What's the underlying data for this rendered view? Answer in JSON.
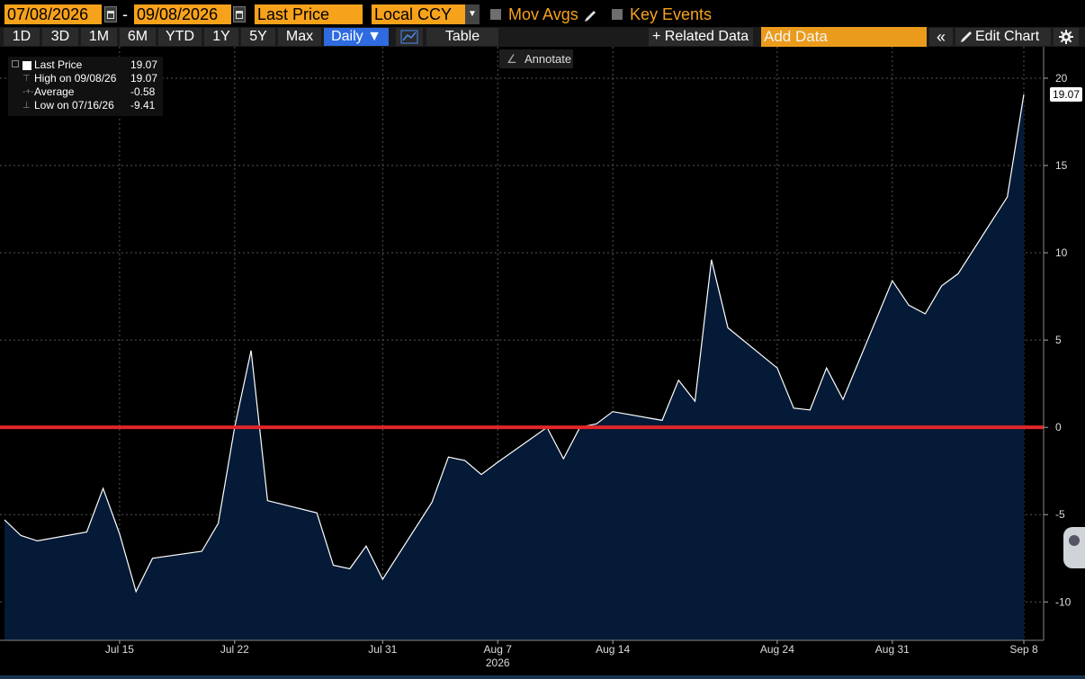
{
  "header": {
    "start_date": "07/08/2026",
    "end_date": "09/08/2026",
    "date_separator": "-",
    "field": "Last Price",
    "currency": "Local CCY",
    "mov_avgs_label": "Mov Avgs",
    "key_events_label": "Key Events"
  },
  "toolbar": {
    "ranges": [
      "1D",
      "3D",
      "1M",
      "6M",
      "YTD",
      "1Y",
      "5Y",
      "Max"
    ],
    "period_label": "Daily ▼",
    "table_label": "Table",
    "related_data_label": "+ Related Data",
    "add_data_placeholder": "Add Data",
    "collapse_label": "«",
    "edit_chart_label": "Edit Chart",
    "settings_icon": "gear-icon"
  },
  "annotate_label": "Annotate",
  "legend": {
    "rows": [
      {
        "label": "Last Price",
        "value": "19.07"
      },
      {
        "label": "High on 09/08/26",
        "value": "19.07"
      },
      {
        "label": "Average",
        "value": "-0.58"
      },
      {
        "label": "Low on 07/16/26",
        "value": "-9.41"
      }
    ]
  },
  "colors": {
    "accent_orange": "#f7a21b",
    "active_blue": "#2e6be0",
    "area_fill": "#041a36",
    "series_line": "#ffffff",
    "zero_line": "#e0262a",
    "grid": "#555555"
  },
  "chart_data": {
    "type": "area",
    "ylim": [
      -12.2,
      21.8
    ],
    "y_ticks": [
      20,
      15,
      10,
      5,
      0,
      -5,
      -10
    ],
    "x_tick_labels": [
      {
        "label": "Jul 15",
        "x": "2026-07-15"
      },
      {
        "label": "Jul 22",
        "x": "2026-07-22"
      },
      {
        "label": "Jul 31",
        "x": "2026-07-31"
      },
      {
        "label": "Aug 7",
        "x": "2026-08-07"
      },
      {
        "label": "Aug 14",
        "x": "2026-08-14"
      },
      {
        "label": "Aug 24",
        "x": "2026-08-24"
      },
      {
        "label": "Aug 31",
        "x": "2026-08-31"
      },
      {
        "label": "Sep 8",
        "x": "2026-09-08"
      }
    ],
    "year_label": "2026",
    "last_value_label": "19.07",
    "reference_line": 0,
    "series": [
      {
        "x": [
          "2026-07-08",
          "2026-07-09",
          "2026-07-10",
          "2026-07-13",
          "2026-07-14",
          "2026-07-15",
          "2026-07-16",
          "2026-07-17",
          "2026-07-20",
          "2026-07-21",
          "2026-07-22",
          "2026-07-23",
          "2026-07-24",
          "2026-07-27",
          "2026-07-28",
          "2026-07-29",
          "2026-07-30",
          "2026-07-31",
          "2026-08-03",
          "2026-08-04",
          "2026-08-05",
          "2026-08-06",
          "2026-08-07",
          "2026-08-10",
          "2026-08-11",
          "2026-08-12",
          "2026-08-13",
          "2026-08-14",
          "2026-08-17",
          "2026-08-18",
          "2026-08-19",
          "2026-08-20",
          "2026-08-21",
          "2026-08-24",
          "2026-08-25",
          "2026-08-26",
          "2026-08-27",
          "2026-08-28",
          "2026-08-31",
          "2026-09-01",
          "2026-09-02",
          "2026-09-03",
          "2026-09-04",
          "2026-09-07",
          "2026-09-08"
        ],
        "values": [
          -5.3,
          -6.2,
          -6.5,
          -6.0,
          -3.5,
          -6.1,
          -9.41,
          -7.5,
          -7.1,
          -5.5,
          0.0,
          4.4,
          -4.2,
          -4.9,
          -7.9,
          -8.1,
          -6.8,
          -8.7,
          -4.3,
          -1.7,
          -1.9,
          -2.7,
          -2.0,
          0.0,
          -1.8,
          0.0,
          0.2,
          0.9,
          0.4,
          2.7,
          1.5,
          9.6,
          5.7,
          3.4,
          1.1,
          1.0,
          3.4,
          1.6,
          8.4,
          7.0,
          6.5,
          8.1,
          8.8,
          13.2,
          19.07
        ]
      }
    ]
  }
}
